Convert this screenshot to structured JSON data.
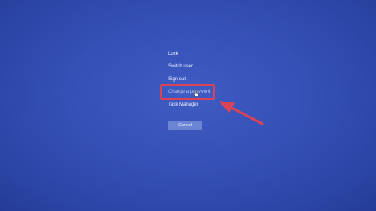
{
  "menu": {
    "items": [
      {
        "label": "Lock"
      },
      {
        "label": "Switch user"
      },
      {
        "label": "Sign out"
      },
      {
        "label": "Change a password"
      },
      {
        "label": "Task Manager"
      }
    ]
  },
  "cancel_label": "Cancel",
  "annotation": {
    "arrow_color": "#d84455",
    "highlight_color": "#d84455"
  },
  "icons": {
    "cursor": "hand-pointer-icon"
  },
  "colors": {
    "background": "#3550b6",
    "button": "#6b84d4"
  }
}
